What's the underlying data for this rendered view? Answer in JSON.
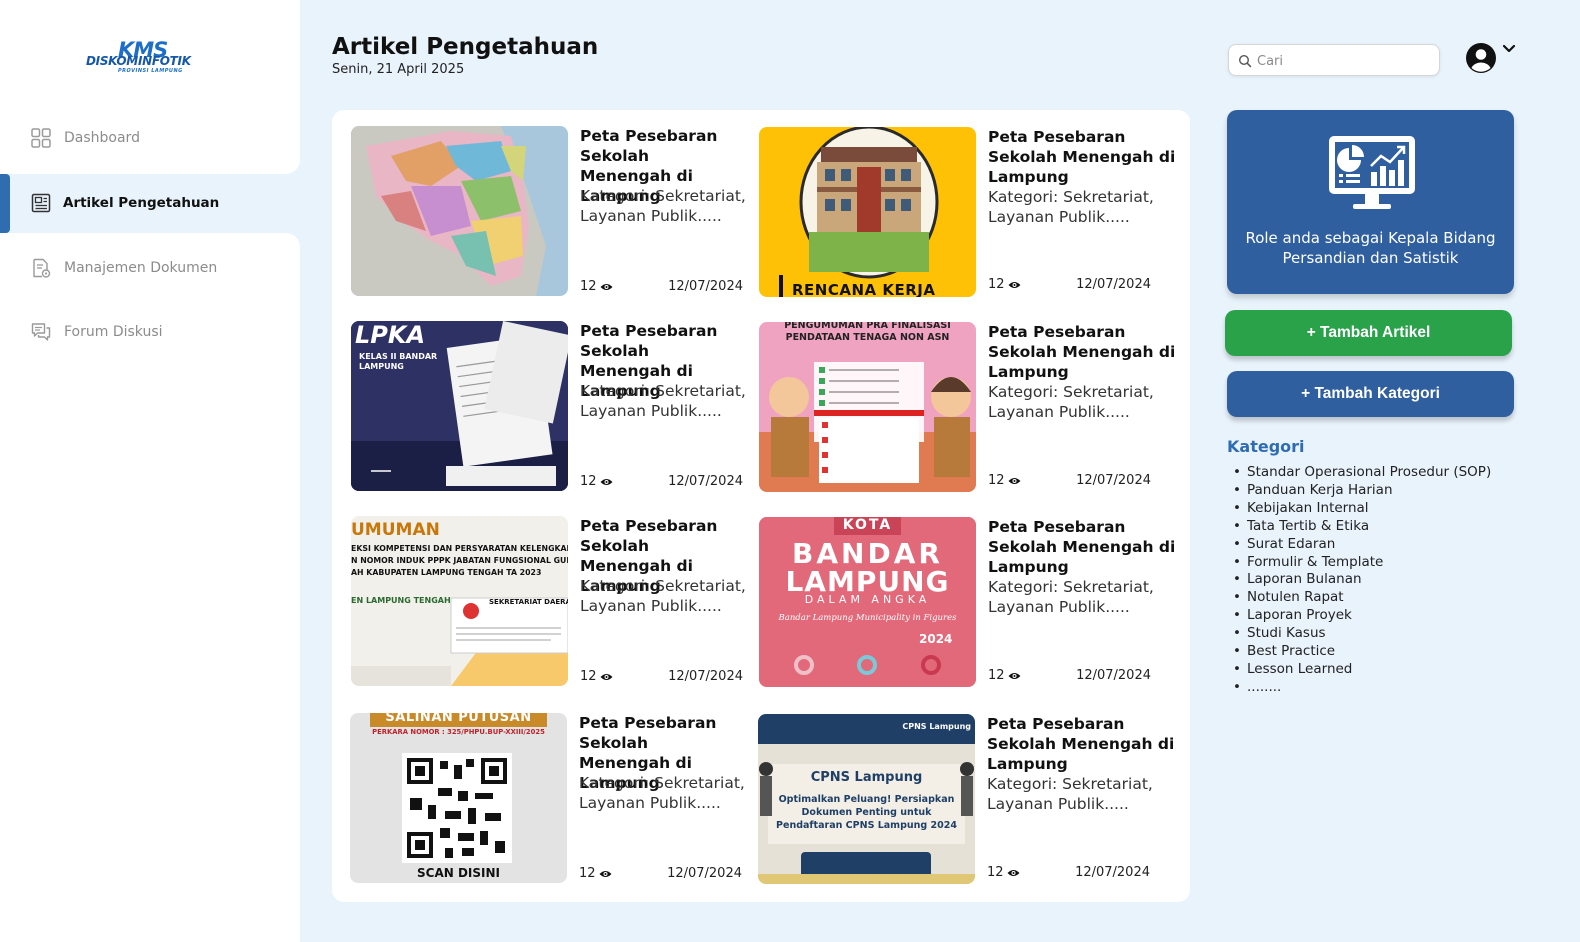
{
  "brand": {
    "logo_main": "KMS",
    "logo_sub": "DISKOMINFOTIK",
    "logo_region": "PROVINSI LAMPUNG"
  },
  "sidebar": {
    "items": [
      {
        "label": "Dashboard",
        "icon": "dashboard-grid-icon",
        "active": false
      },
      {
        "label": "Artikel Pengetahuan",
        "icon": "newspaper-icon",
        "active": true
      },
      {
        "label": "Manajemen Dokumen",
        "icon": "document-settings-icon",
        "active": false
      },
      {
        "label": "Forum Diskusi",
        "icon": "chat-bubbles-icon",
        "active": false
      }
    ]
  },
  "header": {
    "title": "Artikel Pengetahuan",
    "date": "Senin, 21 April 2025",
    "search_placeholder": "Cari"
  },
  "articles": [
    {
      "title": "Peta Pesebaran Sekolah Menengah di Lampung",
      "category": "Kategori: Sekretariat, Layanan Publik.....",
      "views": "12",
      "date": "12/07/2024",
      "thumb": "lampung-map"
    },
    {
      "title": "Peta Pesebaran Sekolah Menengah di Lampung",
      "category": "Kategori: Sekretariat, Layanan Publik.....",
      "views": "12",
      "date": "12/07/2024",
      "thumb": "rencana-kerja",
      "thumb_text": "RENCANA KERJA"
    },
    {
      "title": "Peta Pesebaran Sekolah Menengah di Lampung",
      "category": "Kategori: Sekretariat, Layanan Publik.....",
      "views": "12",
      "date": "12/07/2024",
      "thumb": "lpka",
      "thumb_text": [
        "LPKA",
        "KELAS II BANDAR",
        "LAMPUNG"
      ]
    },
    {
      "title": "Peta Pesebaran Sekolah Menengah di Lampung",
      "category": "Kategori: Sekretariat, Layanan Publik.....",
      "views": "12",
      "date": "12/07/2024",
      "thumb": "non-asn",
      "thumb_text": [
        "PENGUMUMAN PRA FINALISASI",
        "PENDATAAN TENAGA NON ASN"
      ]
    },
    {
      "title": "Peta Pesebaran Sekolah Menengah di Lampung",
      "category": "Kategori: Sekretariat, Layanan Publik.....",
      "views": "12",
      "date": "12/07/2024",
      "thumb": "pengumuman",
      "thumb_text": [
        "UMUMAN",
        "EKSI KOMPETENSI DAN PERSYARATAN KELENGKAPAN DO",
        "N NOMOR INDUK PPPK JABATAN FUNGSIONAL GURU DI LII",
        "AH KABUPATEN LAMPUNG TENGAH TA 2023",
        "EN LAMPUNG TENGAH",
        "SEKRETARIAT DAERA"
      ]
    },
    {
      "title": "Peta Pesebaran Sekolah Menengah di Lampung",
      "category": "Kategori: Sekretariat, Layanan Publik.....",
      "views": "12",
      "date": "12/07/2024",
      "thumb": "bandar-lampung",
      "thumb_text": [
        "KOTA",
        "BANDAR",
        "LAMPUNG",
        "DALAM ANGKA",
        "Bandar Lampung Municipality in Figures",
        "2024"
      ]
    },
    {
      "title": "Peta Pesebaran Sekolah Menengah di Lampung",
      "category": "Kategori: Sekretariat, Layanan Publik.....",
      "views": "12",
      "date": "12/07/2024",
      "thumb": "salinan-putusan",
      "thumb_text": [
        "SALINAN PUTUSAN",
        "PERKARA NOMOR : 325/PHPU.BUP-XXIII/2025",
        "SCAN DISINI"
      ]
    },
    {
      "title": "Peta Pesebaran Sekolah Menengah di Lampung",
      "category": "Kategori: Sekretariat, Layanan Publik.....",
      "views": "12",
      "date": "12/07/2024",
      "thumb": "cpns",
      "thumb_text": [
        "CPNS Lampung",
        "CPNS Lampung",
        "Optimalkan Peluang! Persiapkan",
        "Dokumen Penting untuk",
        "Pendaftaran CPNS Lampung 2024"
      ]
    }
  ],
  "role_card": {
    "text": "Role anda sebagai Kepala Bidang Persandian dan Satistik",
    "icon": "monitor-chart-icon"
  },
  "actions": {
    "add_article": "+ Tambah Artikel",
    "add_category": "+ Tambah Kategori"
  },
  "categories": {
    "heading": "Kategori",
    "items": [
      "Standar Operasional Prosedur (SOP)",
      "Panduan Kerja Harian",
      "Kebijakan Internal",
      "Tata Tertib & Etika",
      "Surat Edaran",
      "Formulir & Template",
      "Laporan Bulanan",
      "Notulen Rapat",
      "Laporan Proyek",
      "Studi Kasus",
      "Best Practice",
      "Lesson Learned",
      "........"
    ]
  },
  "colors": {
    "accent": "#2f5f9e",
    "green": "#2aa24a",
    "background": "#e9f3fc",
    "category_heading": "#2f6db0"
  }
}
